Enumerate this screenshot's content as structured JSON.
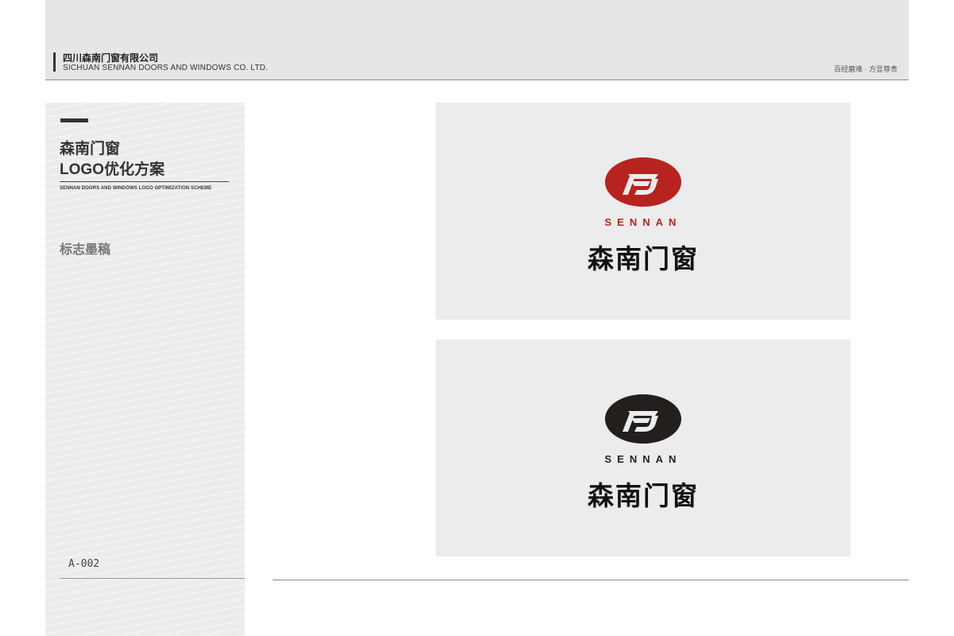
{
  "header": {
    "company_cn": "四川森南门窗有限公司",
    "company_en": "SICHUAN SENNAN DOORS AND WINDOWS CO. LTD.",
    "slogan": "百经磨难 · 方显尊贵"
  },
  "sidebar": {
    "title_line1": "森南门窗",
    "title_line2": "LOGO优化方案",
    "subtitle": "SENNAN DOORS AND WINDOWS LOGO OPTIMIZATION SCHEME",
    "section": "标志墨稿",
    "page_code": "A-002"
  },
  "logos": [
    {
      "wordmark": "SENNAN",
      "name_cn": "森南门窗",
      "color": "#b8231f",
      "variant": "color"
    },
    {
      "wordmark": "SENNAN",
      "name_cn": "森南门窗",
      "color": "#231f1f",
      "variant": "black"
    }
  ],
  "colors": {
    "brand_red": "#b8231f",
    "ink": "#231f1f",
    "panel_bg": "#ececec",
    "header_bg": "#e6e6e6"
  }
}
